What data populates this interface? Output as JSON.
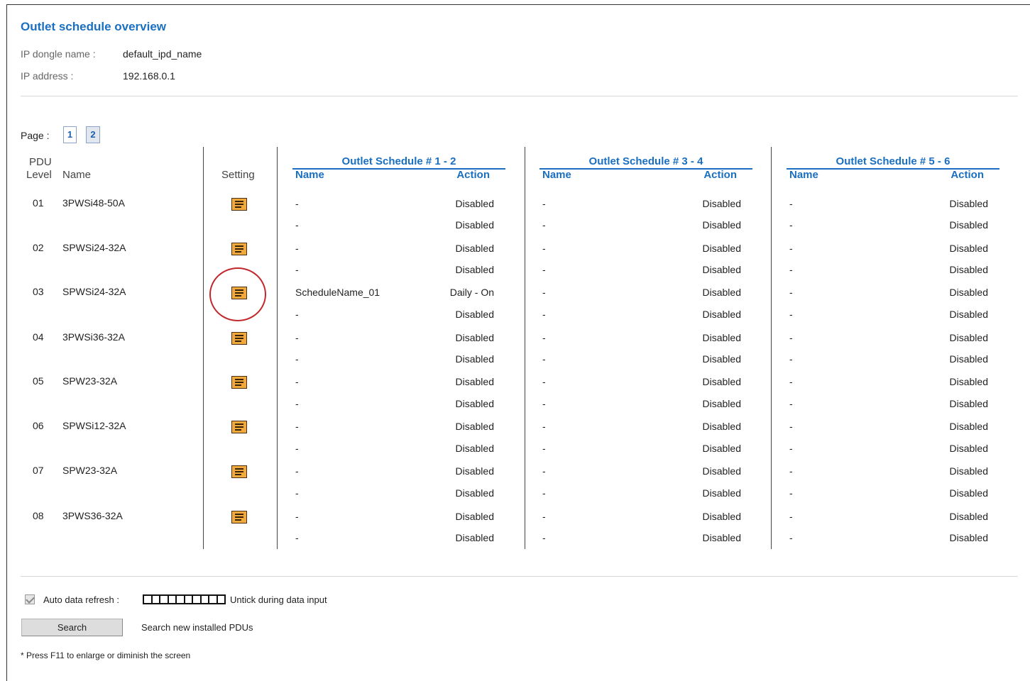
{
  "page": {
    "title": "Outlet schedule overview",
    "dongle_label": "IP dongle name :",
    "dongle_value": "default_ipd_name",
    "ip_label": "IP address :",
    "ip_value": "192.168.0.1"
  },
  "pagination": {
    "label": "Page :",
    "pages": [
      "1",
      "2"
    ],
    "current": "2"
  },
  "table": {
    "headers": {
      "pdu": "PDU",
      "level": "Level",
      "name": "Name",
      "setting": "Setting",
      "groups": [
        "Outlet Schedule # 1 - 2",
        "Outlet Schedule # 3 - 4",
        "Outlet Schedule # 5 - 6"
      ],
      "sub_name": "Name",
      "sub_action": "Action"
    },
    "rows": [
      {
        "level": "01",
        "name": "3PWSi48-50A",
        "groups": [
          [
            {
              "name": "-",
              "action": "Disabled"
            },
            {
              "name": "-",
              "action": "Disabled"
            }
          ],
          [
            {
              "name": "-",
              "action": "Disabled"
            },
            {
              "name": "-",
              "action": "Disabled"
            }
          ],
          [
            {
              "name": "-",
              "action": "Disabled"
            },
            {
              "name": "-",
              "action": "Disabled"
            }
          ]
        ]
      },
      {
        "level": "02",
        "name": "SPWSi24-32A",
        "groups": [
          [
            {
              "name": "-",
              "action": "Disabled"
            },
            {
              "name": "-",
              "action": "Disabled"
            }
          ],
          [
            {
              "name": "-",
              "action": "Disabled"
            },
            {
              "name": "-",
              "action": "Disabled"
            }
          ],
          [
            {
              "name": "-",
              "action": "Disabled"
            },
            {
              "name": "-",
              "action": "Disabled"
            }
          ]
        ]
      },
      {
        "level": "03",
        "name": "SPWSi24-32A",
        "highlighted": true,
        "groups": [
          [
            {
              "name": "ScheduleName_01",
              "action": "Daily - On"
            },
            {
              "name": "-",
              "action": "Disabled"
            }
          ],
          [
            {
              "name": "-",
              "action": "Disabled"
            },
            {
              "name": "-",
              "action": "Disabled"
            }
          ],
          [
            {
              "name": "-",
              "action": "Disabled"
            },
            {
              "name": "-",
              "action": "Disabled"
            }
          ]
        ]
      },
      {
        "level": "04",
        "name": "3PWSi36-32A",
        "groups": [
          [
            {
              "name": "-",
              "action": "Disabled"
            },
            {
              "name": "-",
              "action": "Disabled"
            }
          ],
          [
            {
              "name": "-",
              "action": "Disabled"
            },
            {
              "name": "-",
              "action": "Disabled"
            }
          ],
          [
            {
              "name": "-",
              "action": "Disabled"
            },
            {
              "name": "-",
              "action": "Disabled"
            }
          ]
        ]
      },
      {
        "level": "05",
        "name": "SPW23-32A",
        "groups": [
          [
            {
              "name": "-",
              "action": "Disabled"
            },
            {
              "name": "-",
              "action": "Disabled"
            }
          ],
          [
            {
              "name": "-",
              "action": "Disabled"
            },
            {
              "name": "-",
              "action": "Disabled"
            }
          ],
          [
            {
              "name": "-",
              "action": "Disabled"
            },
            {
              "name": "-",
              "action": "Disabled"
            }
          ]
        ]
      },
      {
        "level": "06",
        "name": "SPWSi12-32A",
        "groups": [
          [
            {
              "name": "-",
              "action": "Disabled"
            },
            {
              "name": "-",
              "action": "Disabled"
            }
          ],
          [
            {
              "name": "-",
              "action": "Disabled"
            },
            {
              "name": "-",
              "action": "Disabled"
            }
          ],
          [
            {
              "name": "-",
              "action": "Disabled"
            },
            {
              "name": "-",
              "action": "Disabled"
            }
          ]
        ]
      },
      {
        "level": "07",
        "name": "SPW23-32A",
        "groups": [
          [
            {
              "name": "-",
              "action": "Disabled"
            },
            {
              "name": "-",
              "action": "Disabled"
            }
          ],
          [
            {
              "name": "-",
              "action": "Disabled"
            },
            {
              "name": "-",
              "action": "Disabled"
            }
          ],
          [
            {
              "name": "-",
              "action": "Disabled"
            },
            {
              "name": "-",
              "action": "Disabled"
            }
          ]
        ]
      },
      {
        "level": "08",
        "name": "3PWS36-32A",
        "groups": [
          [
            {
              "name": "-",
              "action": "Disabled"
            },
            {
              "name": "-",
              "action": "Disabled"
            }
          ],
          [
            {
              "name": "-",
              "action": "Disabled"
            },
            {
              "name": "-",
              "action": "Disabled"
            }
          ],
          [
            {
              "name": "-",
              "action": "Disabled"
            },
            {
              "name": "-",
              "action": "Disabled"
            }
          ]
        ]
      }
    ]
  },
  "footer": {
    "auto_refresh_label": "Auto data refresh :",
    "auto_refresh_checked": true,
    "untick_note": "Untick during data input",
    "search_button": "Search",
    "search_note": "Search new installed PDUs",
    "f11_note": "* Press F11 to enlarge or diminish the screen"
  },
  "colors": {
    "accent": "#1a6fc0",
    "setting_icon": "#f2a93b",
    "highlight": "#c0282d"
  },
  "icons": {
    "setting": "schedule-settings-icon"
  }
}
